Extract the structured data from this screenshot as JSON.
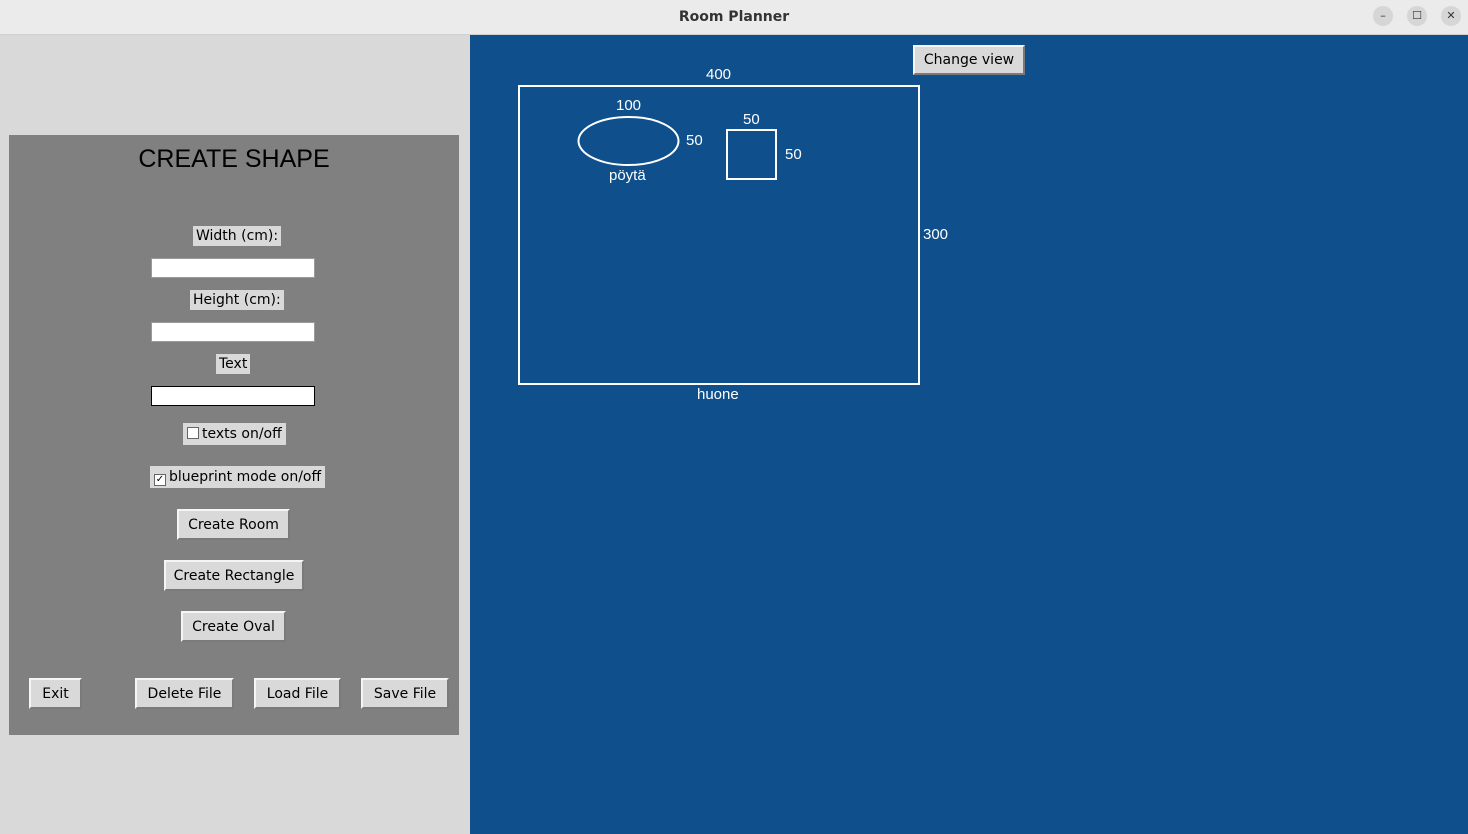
{
  "window": {
    "title": "Room Planner",
    "controls": {
      "minimize": "–",
      "maximize": "☐",
      "close": "✕"
    }
  },
  "panel": {
    "title": "CREATE SHAPE",
    "width_label": "Width (cm):",
    "width_value": "",
    "height_label": "Height (cm):",
    "height_value": "",
    "text_label": "Text",
    "text_value": "",
    "texts_toggle": {
      "label": "texts on/off",
      "checked": false
    },
    "blueprint_toggle": {
      "label": "blueprint mode on/off",
      "checked": true
    },
    "buttons": {
      "create_room": "Create Room",
      "create_rectangle": "Create Rectangle",
      "create_oval": "Create Oval",
      "exit": "Exit",
      "delete_file": "Delete File",
      "load_file": "Load File",
      "save_file": "Save File"
    }
  },
  "canvas": {
    "background": "#0f4f8c",
    "change_view": "Change view",
    "room": {
      "name": "huone",
      "width": "400",
      "height": "300"
    },
    "oval": {
      "name": "pöytä",
      "width": "100",
      "height": "50"
    },
    "rectangle": {
      "width": "50",
      "height": "50"
    }
  }
}
